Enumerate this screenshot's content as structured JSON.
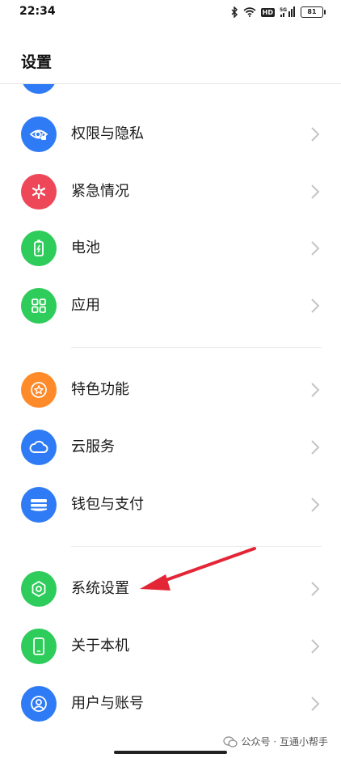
{
  "status_bar": {
    "time": "22:34",
    "battery": "81",
    "hd": "HD",
    "network": "5G"
  },
  "header": {
    "title": "设置"
  },
  "colors": {
    "blue": "#2f7bf5",
    "red": "#ee4758",
    "green": "#2ecc5a",
    "orange": "#ff8a2a",
    "arrow": "#e32636"
  },
  "settings": {
    "items": [
      {
        "label": "权限与隐私",
        "icon": "eye-lock-icon",
        "color": "#2f7bf5"
      },
      {
        "label": "紧急情况",
        "icon": "asterisk-icon",
        "color": "#ee4758"
      },
      {
        "label": "电池",
        "icon": "battery-icon",
        "color": "#2ecc5a"
      },
      {
        "label": "应用",
        "icon": "grid-icon",
        "color": "#2ecc5a"
      },
      {
        "label": "特色功能",
        "icon": "star-circle-icon",
        "color": "#ff8a2a"
      },
      {
        "label": "云服务",
        "icon": "cloud-icon",
        "color": "#2f7bf5"
      },
      {
        "label": "钱包与支付",
        "icon": "wallet-icon",
        "color": "#2f7bf5"
      },
      {
        "label": "系统设置",
        "icon": "hexagon-gear-icon",
        "color": "#2ecc5a"
      },
      {
        "label": "关于本机",
        "icon": "phone-icon",
        "color": "#2ecc5a"
      },
      {
        "label": "用户与账号",
        "icon": "user-icon",
        "color": "#2f7bf5"
      }
    ]
  },
  "watermark": {
    "text": "公众号 · 互通小帮手"
  }
}
